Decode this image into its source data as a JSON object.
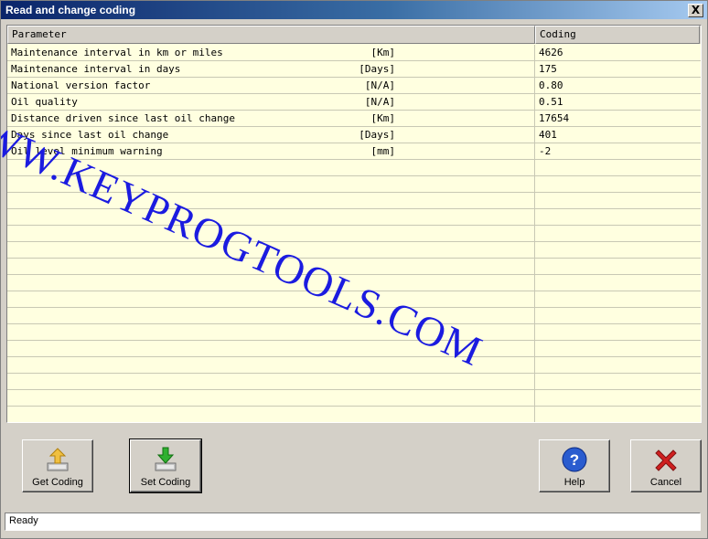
{
  "window": {
    "title": "Read and change coding",
    "close_label": "X"
  },
  "grid": {
    "columns": {
      "parameter": "Parameter",
      "coding": "Coding"
    },
    "rows": [
      {
        "parameter": "Maintenance interval in km or miles",
        "unit": "[Km]",
        "coding": "4626"
      },
      {
        "parameter": "Maintenance interval in days",
        "unit": "[Days]",
        "coding": "175"
      },
      {
        "parameter": "National version factor",
        "unit": "[N/A]",
        "coding": "0.80"
      },
      {
        "parameter": "Oil quality",
        "unit": "[N/A]",
        "coding": "0.51"
      },
      {
        "parameter": "Distance driven since last oil change",
        "unit": "[Km]",
        "coding": "17654"
      },
      {
        "parameter": "Days since last oil change",
        "unit": "[Days]",
        "coding": "401"
      },
      {
        "parameter": "Oil level minimum warning",
        "unit": "[mm]",
        "coding": "-2"
      }
    ]
  },
  "watermark": "WWW.KEYPROGTOOLS.COM",
  "buttons": {
    "get_coding": "Get Coding",
    "set_coding": "Set Coding",
    "help": "Help",
    "cancel": "Cancel"
  },
  "icons": {
    "get_coding": "folder-up-icon",
    "set_coding": "download-arrow-icon",
    "help": "question-icon",
    "cancel": "red-x-icon"
  },
  "status": {
    "text": "Ready"
  },
  "colors": {
    "title_bar": "#0a246a",
    "grid_bg": "#ffffe0",
    "watermark": "#1b1be0"
  }
}
